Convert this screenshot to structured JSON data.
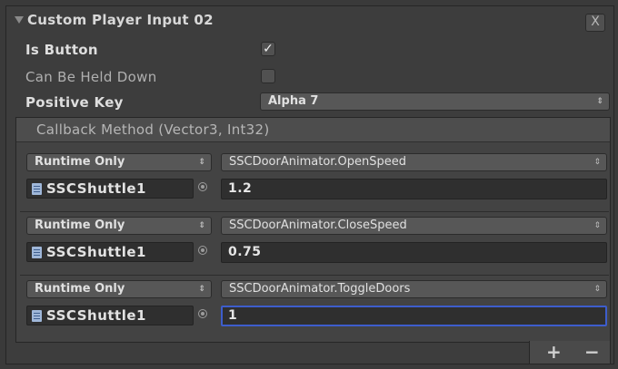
{
  "header": {
    "title": "Custom Player Input 02",
    "close_label": "X"
  },
  "properties": {
    "is_button": {
      "label": "Is Button",
      "checked": true,
      "check_glyph": "✓"
    },
    "can_be_held_down": {
      "label": "Can Be Held Down",
      "checked": false,
      "check_glyph": ""
    },
    "positive_key": {
      "label": "Positive Key",
      "value": "Alpha 7"
    }
  },
  "event": {
    "title": "Callback Method (Vector3, Int32)",
    "entries": [
      {
        "mode": "Runtime Only",
        "method": "SSCDoorAnimator.OpenSpeed",
        "object": "SSCShuttle1",
        "value": "1.2",
        "focused": false
      },
      {
        "mode": "Runtime Only",
        "method": "SSCDoorAnimator.CloseSpeed",
        "object": "SSCShuttle1",
        "value": "0.75",
        "focused": false
      },
      {
        "mode": "Runtime Only",
        "method": "SSCDoorAnimator.ToggleDoors",
        "object": "SSCShuttle1",
        "value": "1",
        "focused": true
      }
    ],
    "add_label": "+",
    "remove_label": "−"
  },
  "icons": {
    "foldout": "foldout-arrow-icon",
    "popup_arrows": "up-down-arrows-icon",
    "script": "script-icon",
    "object_picker": "object-picker-icon"
  },
  "colors": {
    "background": "#3a3a3a",
    "focus_border": "#3d5dcc",
    "field_bg": "#2f2f2f",
    "popup_bg": "#575757"
  }
}
